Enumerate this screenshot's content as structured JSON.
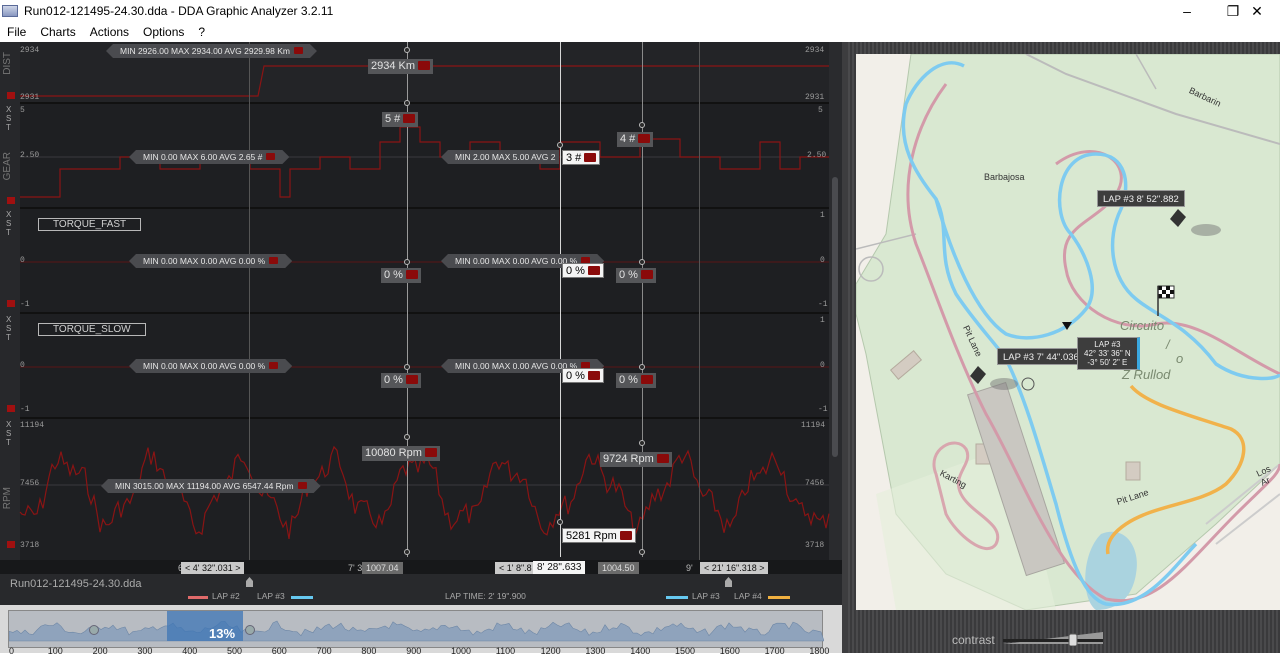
{
  "window": {
    "title": "Run012-121495-24.30.dda - DDA Graphic Analyzer 3.2.11",
    "minimize": "–",
    "maximize": "❐",
    "close": "✕"
  },
  "menu": [
    "File",
    "Charts",
    "Actions",
    "Options",
    "?"
  ],
  "tracks": {
    "dist": {
      "label": "DIST",
      "axis_top": "2934",
      "axis_bottom": "2931",
      "stats": "MIN 2926.00 MAX 2934.00 AVG 2929.98 Km",
      "cursor_value": "2934 Km"
    },
    "gear": {
      "label": "GEAR",
      "axis_top": "5",
      "axis_mid": "2.50",
      "axis_right_mid": "2.50",
      "stats_left": "MIN 0.00 MAX 6.00 AVG 2.65 #",
      "stats_right": "MIN 2.00 MAX 5.00 AVG 2",
      "val_a": "5 #",
      "val_b": "3 #",
      "val_c": "4 #"
    },
    "torque_fast": {
      "name": "TORQUE_FAST",
      "axis_top": "1",
      "axis_mid": "0",
      "axis_bottom": "-1",
      "stats_left": "MIN 0.00 MAX 0.00 AVG 0.00 %",
      "stats_right": "MIN 0.00 MAX 0.00 AVG 0.00 %",
      "val_a": "0 %",
      "val_b": "0 %",
      "val_c": "0 %"
    },
    "torque_slow": {
      "name": "TORQUE_SLOW",
      "axis_top": "1",
      "axis_mid": "0",
      "axis_bottom": "-1",
      "stats_left": "MIN 0.00 MAX 0.00 AVG 0.00 %",
      "stats_right": "MIN 0.00 MAX 0.00 AVG 0.00 %",
      "val_a": "0 %",
      "val_b": "0 %",
      "val_c": "0 %"
    },
    "rpm": {
      "label": "RPM",
      "axis_top": "11194",
      "axis_mid": "7456",
      "axis_bottom": "3718",
      "stats": "MIN 3015.00 MAX 11194.00 AVG 6547.44 Rpm",
      "val_a": "10080 Rpm",
      "val_b": "9724 Rpm",
      "val_c": "5281 Rpm"
    }
  },
  "controls": {
    "x": "X",
    "s": "S",
    "t": "T"
  },
  "time_strip": {
    "left": "< 4' 32\".031 >",
    "left_prefix": "6",
    "left_mid": "7' 3",
    "mid_a": "1007.04",
    "center": "< 1' 8\".8",
    "center_main": "8' 28\".633",
    "mid_b": "1004.50",
    "right_prefix": "9'",
    "right": "< 21' 16\".318 >"
  },
  "laps_strip": {
    "file": "Run012-121495-24.30.dda",
    "lap2": "LAP #2",
    "lap3_left": "LAP #3",
    "lap_time": "LAP TIME: 2' 19\".900",
    "lap3_right": "LAP #3",
    "lap4": "LAP #4",
    "colors": {
      "lap2": "#e06a6a",
      "lap3": "#66c8f0",
      "lap4": "#f0b040"
    }
  },
  "overview": {
    "percent": "13%",
    "ticks": [
      "0",
      "100",
      "200",
      "300",
      "400",
      "500",
      "600",
      "700",
      "800",
      "900",
      "1000",
      "1100",
      "1200",
      "1300",
      "1400",
      "1500",
      "1600",
      "1700",
      "1800"
    ]
  },
  "map": {
    "labels": {
      "barbajosa": "Barbajosa",
      "barbarin": "Barbarin",
      "pit_lane_1": "Pit Lane",
      "pit_lane_2": "Pit Lane",
      "karting": "Karting",
      "los_arcos": "Los Ar",
      "circuito": "Circuito",
      "circuito_2": "o",
      "circuito_3": "Z Rullod",
      "slash": "/"
    },
    "callout_a": "LAP #3 8' 52\".882",
    "callout_b": "LAP #3 7' 44\".036",
    "lap_info": [
      "LAP #3",
      "42° 33' 36\" N",
      "-3° 50' 2\" E"
    ]
  },
  "contrast": {
    "label": "contrast"
  }
}
